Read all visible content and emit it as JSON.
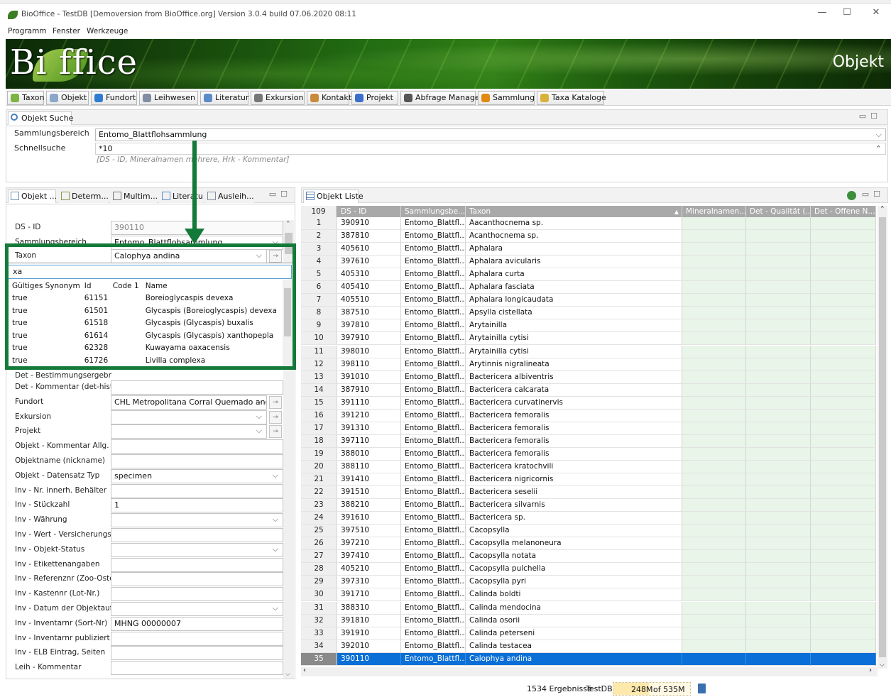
{
  "window": {
    "title": "BioOffice - TestDB [Demoversion from BioOffice.org] Version 3.0.4 build 07.06.2020 08:11"
  },
  "menu": [
    "Programm",
    "Fenster",
    "Werkzeuge"
  ],
  "banner": {
    "logo": "Bi  ffice",
    "section": "Objekt"
  },
  "toolbar": [
    {
      "label": "Taxon",
      "icon": "taxon-icon",
      "color": "#7cb342"
    },
    {
      "label": "Objekt",
      "icon": "object-icon",
      "color": "#8aa6c9"
    },
    {
      "label": "Fundort",
      "icon": "globe-icon",
      "color": "#2e7dd1"
    },
    {
      "label": "Leihwesen",
      "icon": "loan-icon",
      "color": "#7f8ea0"
    },
    {
      "label": "Literatur",
      "icon": "book-icon",
      "color": "#5b8ac8"
    },
    {
      "label": "Exkursion",
      "icon": "bus-icon",
      "color": "#777"
    },
    {
      "label": "Kontakt",
      "icon": "contact-icon",
      "color": "#c98a3b"
    },
    {
      "label": "Projekt",
      "icon": "flag-icon",
      "color": "#3b6fc9"
    },
    {
      "label": "Abfrage Manager",
      "icon": "binoculars-icon",
      "color": "#555"
    },
    {
      "label": "Sammlung",
      "icon": "drawer-icon",
      "color": "#e08a12"
    },
    {
      "label": "Taxa Kataloge",
      "icon": "folder-icon",
      "color": "#d8b23a"
    }
  ],
  "search": {
    "panel_title": "Objekt Suche",
    "sammlungsbereich_label": "Sammlungsbereich",
    "sammlungsbereich_value": "Entomo_Blattflohsammlung",
    "schnellsuche_label": "Schnellsuche",
    "schnellsuche_value": "*10",
    "schnellsuche_hint": "[DS - ID, Mineralnamen mehrere, Hrk - Kommentar]"
  },
  "detail_tabs": [
    "Objekt ...",
    "Determ...",
    "Multim...",
    "Literatu",
    "Ausleih..."
  ],
  "detail": {
    "dsid_label": "DS - ID",
    "dsid_value": "390110",
    "sammlungsbereich_label": "Sammlungsbereich",
    "sammlungsbereich_value": "Entomo_Blattflohsammlung",
    "taxon_label": "Taxon",
    "taxon_value": "Calophya andina",
    "det_result_label": "Det - Bestimmungsergebni",
    "fields": [
      {
        "label": "Det - Kommentar (det-hist.",
        "value": "",
        "dd": false,
        "go": false
      },
      {
        "label": "Fundort",
        "value": "CHL Metropolitana Corral Quemado and",
        "dd": true,
        "go": true
      },
      {
        "label": "Exkursion",
        "value": "",
        "dd": true,
        "go": true
      },
      {
        "label": "Projekt",
        "value": "",
        "dd": true,
        "go": true
      },
      {
        "label": "Objekt - Kommentar Allg.",
        "value": "",
        "dd": false,
        "go": false
      },
      {
        "label": "Objektname (nickname)",
        "value": "",
        "dd": false,
        "go": false
      },
      {
        "label": "Objekt - Datensatz Typ",
        "value": "specimen",
        "dd": true,
        "go": false
      },
      {
        "label": "Inv - Nr. innerh. Behälter",
        "value": "",
        "dd": false,
        "go": false
      },
      {
        "label": "Inv - Stückzahl",
        "value": "1",
        "dd": false,
        "go": false
      },
      {
        "label": "Inv - Währung",
        "value": "",
        "dd": true,
        "go": false
      },
      {
        "label": "Inv - Wert - Versicherungsw",
        "value": "",
        "dd": false,
        "go": false
      },
      {
        "label": "Inv - Objekt-Status",
        "value": "",
        "dd": true,
        "go": false
      },
      {
        "label": "Inv - Etikettenangaben",
        "value": "",
        "dd": false,
        "go": false
      },
      {
        "label": "Inv - Referenznr (Zoo-Oste",
        "value": "",
        "dd": false,
        "go": false
      },
      {
        "label": "Inv - Kastennr (Lot-Nr.)",
        "value": "",
        "dd": false,
        "go": false
      },
      {
        "label": "Inv - Datum der Objektaufr",
        "value": "",
        "dd": true,
        "go": false
      },
      {
        "label": "Inv - Inventarnr  (Sort-Nr)",
        "value": "MHNG 00000007",
        "dd": false,
        "go": false
      },
      {
        "label": "Inv - Inventarnr publiziert (",
        "value": "",
        "dd": false,
        "go": false
      },
      {
        "label": "Inv - ELB Eintrag, Seiten",
        "value": "",
        "dd": false,
        "go": false
      },
      {
        "label": "Leih - Kommentar",
        "value": "",
        "dd": false,
        "go": false
      }
    ]
  },
  "taxon_popup": {
    "filter": "xa",
    "columns": [
      "Gültiges Synonym",
      "Id",
      "Code 1",
      "Name"
    ],
    "rows": [
      [
        "true",
        "61151",
        "",
        "Boreioglycaspis devexa"
      ],
      [
        "true",
        "61501",
        "",
        "Glycaspis (Boreioglycaspis) devexa"
      ],
      [
        "true",
        "61518",
        "",
        "Glycaspis (Glycaspis) buxalis"
      ],
      [
        "true",
        "61614",
        "",
        "Glycaspis (Glycaspis) xanthopepla"
      ],
      [
        "true",
        "62328",
        "",
        "Kuwayama oaxacensis"
      ],
      [
        "true",
        "61726",
        "",
        "Livilla complexa"
      ]
    ]
  },
  "list": {
    "panel_title": "Objekt Liste",
    "count": "109",
    "columns": [
      "DS - ID",
      "Sammlungsbe...",
      "Taxon",
      "Mineralnamen...",
      "Det - Qualität (...",
      "Det - Offene N..."
    ],
    "selected_row": 35,
    "rows": [
      [
        "1",
        "390910",
        "Entomo_Blattfl...",
        "Aacanthocnema sp."
      ],
      [
        "2",
        "387810",
        "Entomo_Blattfl...",
        "Acanthocnema sp."
      ],
      [
        "3",
        "405610",
        "Entomo_Blattfl...",
        "Aphalara"
      ],
      [
        "4",
        "397610",
        "Entomo_Blattfl...",
        "Aphalara avicularis"
      ],
      [
        "5",
        "405310",
        "Entomo_Blattfl...",
        "Aphalara curta"
      ],
      [
        "6",
        "405410",
        "Entomo_Blattfl...",
        "Aphalara fasciata"
      ],
      [
        "7",
        "405510",
        "Entomo_Blattfl...",
        "Aphalara longicaudata"
      ],
      [
        "8",
        "387510",
        "Entomo_Blattfl...",
        "Apsylla cistellata"
      ],
      [
        "9",
        "397810",
        "Entomo_Blattfl...",
        "Arytainilla"
      ],
      [
        "10",
        "397910",
        "Entomo_Blattfl...",
        "Arytainilla cytisi"
      ],
      [
        "11",
        "398010",
        "Entomo_Blattfl...",
        "Arytainilla cytisi"
      ],
      [
        "12",
        "398110",
        "Entomo_Blattfl...",
        "Arytinnis nigralineata"
      ],
      [
        "13",
        "391010",
        "Entomo_Blattfl...",
        "Bactericera albiventris"
      ],
      [
        "14",
        "387910",
        "Entomo_Blattfl...",
        "Bactericera calcarata"
      ],
      [
        "15",
        "391110",
        "Entomo_Blattfl...",
        "Bactericera curvatinervis"
      ],
      [
        "16",
        "391210",
        "Entomo_Blattfl...",
        "Bactericera femoralis"
      ],
      [
        "17",
        "391310",
        "Entomo_Blattfl...",
        "Bactericera femoralis"
      ],
      [
        "18",
        "397110",
        "Entomo_Blattfl...",
        "Bactericera femoralis"
      ],
      [
        "19",
        "388010",
        "Entomo_Blattfl...",
        "Bactericera femoralis"
      ],
      [
        "20",
        "388110",
        "Entomo_Blattfl...",
        "Bactericera kratochvili"
      ],
      [
        "21",
        "391410",
        "Entomo_Blattfl...",
        "Bactericera nigricornis"
      ],
      [
        "22",
        "391510",
        "Entomo_Blattfl...",
        "Bactericera seselii"
      ],
      [
        "23",
        "388210",
        "Entomo_Blattfl...",
        "Bactericera silvarnis"
      ],
      [
        "24",
        "391610",
        "Entomo_Blattfl...",
        "Bactericera sp."
      ],
      [
        "25",
        "397510",
        "Entomo_Blattfl...",
        "Cacopsylla"
      ],
      [
        "26",
        "397210",
        "Entomo_Blattfl...",
        "Cacopsylla melanoneura"
      ],
      [
        "27",
        "397410",
        "Entomo_Blattfl...",
        "Cacopsylla notata"
      ],
      [
        "28",
        "405210",
        "Entomo_Blattfl...",
        "Cacopsylla pulchella"
      ],
      [
        "29",
        "397310",
        "Entomo_Blattfl...",
        "Cacopsylla pyri"
      ],
      [
        "30",
        "391710",
        "Entomo_Blattfl...",
        "Calinda boldti"
      ],
      [
        "31",
        "388310",
        "Entomo_Blattfl...",
        "Calinda mendocina"
      ],
      [
        "32",
        "391810",
        "Entomo_Blattfl...",
        "Calinda osorii"
      ],
      [
        "33",
        "391910",
        "Entomo_Blattfl...",
        "Calinda peterseni"
      ],
      [
        "34",
        "392010",
        "Entomo_Blattfl...",
        "Calinda testacea"
      ],
      [
        "35",
        "390110",
        "Entomo_Blattfl...",
        "Calophya andina"
      ]
    ]
  },
  "status": {
    "results": "1534 Ergebnisse",
    "db": "TestDB",
    "mem_used": "248M",
    "mem_total": "of 535M",
    "mem_fraction": 0.46
  },
  "colors": {
    "accent": "#147a3a",
    "selected": "#0a6fd6",
    "rowgreen": "#e8f5e8",
    "header": "#a9a9a9"
  }
}
